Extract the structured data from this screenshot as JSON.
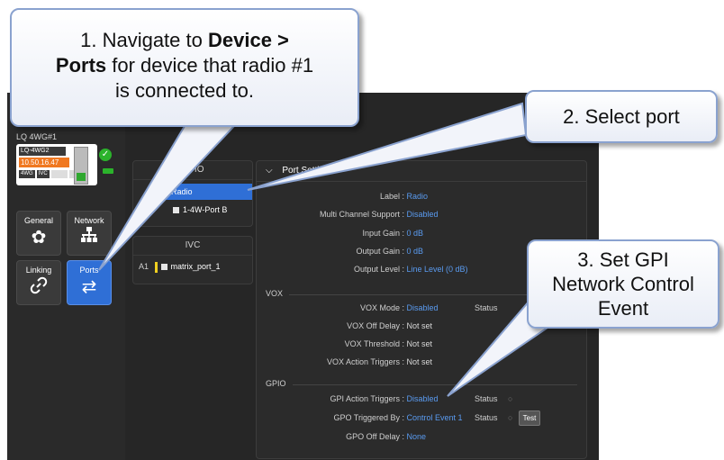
{
  "device": {
    "sidebar_label": "LQ 4WG#1",
    "card_name": "LQ-4WG2",
    "card_ip": "10.50.16.47",
    "tags": [
      "4WG",
      "IVC"
    ],
    "status_ok": "✓"
  },
  "nav": {
    "general": {
      "label": "General",
      "icon": "gear-icon",
      "glyph": "✿"
    },
    "network": {
      "label": "Network",
      "icon": "network-icon",
      "glyph": "⊥"
    },
    "linking": {
      "label": "Linking",
      "icon": "link-icon",
      "glyph": "⚯"
    },
    "ports": {
      "label": "Ports",
      "icon": "swap-arrows-icon",
      "glyph": "⇄"
    }
  },
  "gpio_column": {
    "title": "GPIO",
    "ports": [
      "Radio",
      "1-4W-Port B"
    ]
  },
  "ivc_column": {
    "title": "IVC",
    "rows": [
      {
        "slot": "A1",
        "name": "matrix_port_1"
      }
    ]
  },
  "settings": {
    "header": "Port Settings",
    "label": {
      "key": "Label :",
      "value": "Radio"
    },
    "multi_channel": {
      "key": "Multi Channel Support :",
      "value": "Disabled"
    },
    "input_gain": {
      "key": "Input Gain :",
      "value": "0 dB"
    },
    "output_gain": {
      "key": "Output Gain :",
      "value": "0 dB"
    },
    "output_level": {
      "key": "Output Level :",
      "value": "Line Level (0 dB)"
    },
    "vox_section": "VOX",
    "vox_mode": {
      "key": "VOX Mode :",
      "value": "Disabled",
      "status": "Status"
    },
    "vox_off_delay": {
      "key": "VOX Off Delay :",
      "value": "Not set"
    },
    "vox_threshold": {
      "key": "VOX Threshold :",
      "value": "Not set"
    },
    "vox_action": {
      "key": "VOX Action Triggers :",
      "value": "Not set"
    },
    "gpio_section": "GPIO",
    "gpi_action": {
      "key": "GPI Action Triggers :",
      "value": "Disabled",
      "status": "Status"
    },
    "gpo_triggered": {
      "key": "GPO Triggered By :",
      "value": "Control Event 1",
      "status": "Status",
      "test": "Test"
    },
    "gpo_off_delay": {
      "key": "GPO Off Delay :",
      "value": "None"
    }
  },
  "callouts": {
    "one_a": "1. Navigate to ",
    "one_bold1": "Device >",
    "one_bold2": "Ports",
    "one_b": " for device that radio #1",
    "one_c": "is connected to.",
    "two": "2. Select port",
    "three_a": "3. Set GPI",
    "three_b": "Network Control",
    "three_c": "Event"
  },
  "colors": {
    "accent": "#2f6fd6",
    "link": "#5a9bf0",
    "ip_badge": "#f07820",
    "ok": "#2bb32b",
    "callout_border": "#8aa2cf"
  }
}
